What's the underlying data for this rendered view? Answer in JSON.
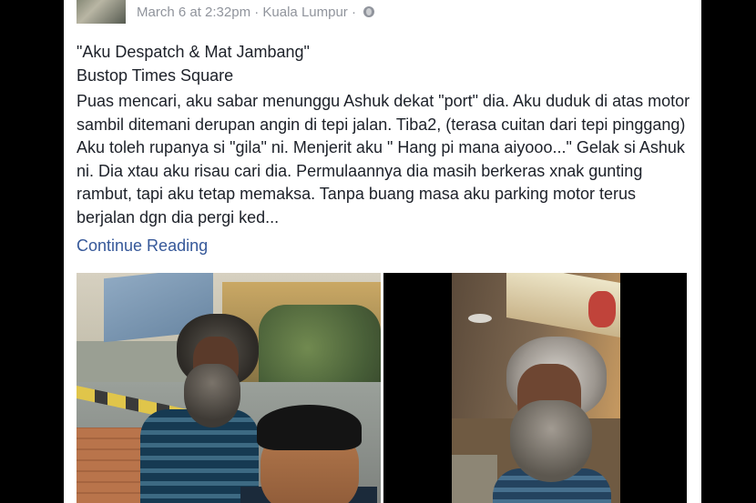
{
  "post": {
    "timestamp": "March 6 at 2:32pm",
    "separator": "·",
    "location": "Kuala Lumpur",
    "title_line1": "\"Aku Despatch & Mat Jambang\"",
    "title_line2": "Bustop Times Square",
    "body": "Puas mencari, aku sabar menunggu Ashuk dekat \"port\" dia. Aku duduk di atas motor sambil ditemani derupan angin di tepi jalan. Tiba2, (terasa cuitan dari tepi pinggang) Aku toleh rupanya si \"gila\" ni. Menjerit aku \" Hang pi mana aiyooo...\" Gelak si Ashuk ni. Dia xtau aku risau cari dia. Permulaannya dia masih berkeras xnak gunting rambut, tapi aku tetap memaksa. Tanpa buang masa aku parking motor terus berjalan dgn dia pergi ked...",
    "continue_label": "Continue Reading"
  },
  "icons": {
    "privacy": "globe-icon"
  },
  "colors": {
    "meta_text": "#90949c",
    "body_text": "#1d2129",
    "link": "#365899",
    "background": "#000000"
  }
}
